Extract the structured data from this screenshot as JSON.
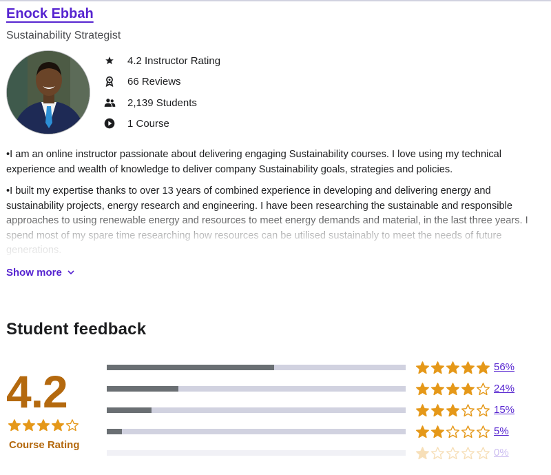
{
  "instructor": {
    "name": "Enock Ebbah",
    "headline": "Sustainability Strategist",
    "stats": [
      {
        "icon": "star-icon",
        "label": "4.2 Instructor Rating"
      },
      {
        "icon": "award-icon",
        "label": "66 Reviews"
      },
      {
        "icon": "people-icon",
        "label": "2,139 Students"
      },
      {
        "icon": "play-icon",
        "label": "1 Course"
      }
    ],
    "bio": [
      "•I am an online instructor passionate about delivering engaging Sustainability courses. I love using my technical experience and wealth of knowledge to deliver company Sustainability goals, strategies and policies.",
      "•I built my expertise thanks to over 13 years of combined experience in developing and delivering energy and sustainability projects, energy research and engineering. I have been researching the sustainable and responsible approaches to using renewable energy and resources to meet energy demands and material, in the last three years. I spend most of my spare time researching how resources can be utilised sustainably to meet the needs of future generations."
    ],
    "show_more_label": "Show more"
  },
  "feedback": {
    "title": "Student feedback",
    "average": "4.2",
    "average_stars": 4,
    "rating_label": "Course Rating",
    "breakdown": [
      {
        "stars": 5,
        "percent": 56,
        "label": "56%"
      },
      {
        "stars": 4,
        "percent": 24,
        "label": "24%"
      },
      {
        "stars": 3,
        "percent": 15,
        "label": "15%"
      },
      {
        "stars": 2,
        "percent": 5,
        "label": "5%"
      },
      {
        "stars": 1,
        "percent": 0,
        "label": "0%"
      }
    ]
  },
  "colors": {
    "accent": "#5624d0",
    "rating": "#b4690e",
    "star": "#e59819",
    "bar_fill": "#6a6f73",
    "bar_track": "#d1d2e0"
  }
}
